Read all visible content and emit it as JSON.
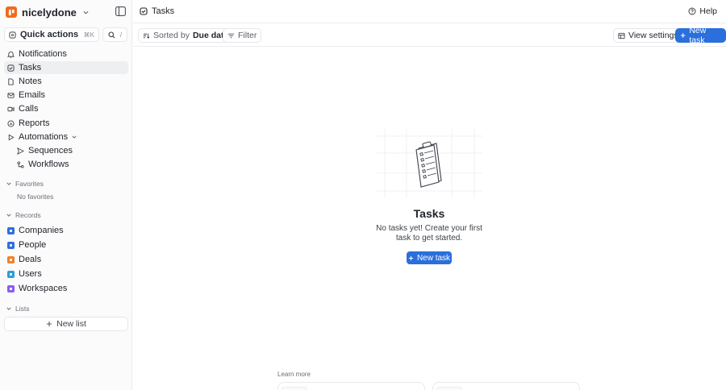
{
  "workspace": {
    "name": "nicelydone",
    "brand_color": "#f26a1b"
  },
  "quick_actions": {
    "label": "Quick actions",
    "shortcut": "⌘K",
    "slash": "/"
  },
  "nav": [
    {
      "label": "Notifications",
      "icon": "bell-icon"
    },
    {
      "label": "Tasks",
      "icon": "checkbox-icon",
      "active": true
    },
    {
      "label": "Notes",
      "icon": "note-icon"
    },
    {
      "label": "Emails",
      "icon": "mail-icon"
    },
    {
      "label": "Calls",
      "icon": "video-icon"
    },
    {
      "label": "Reports",
      "icon": "chart-icon"
    },
    {
      "label": "Automations",
      "icon": "play-icon"
    }
  ],
  "automations_sub": [
    {
      "label": "Sequences",
      "icon": "send-icon"
    },
    {
      "label": "Workflows",
      "icon": "workflow-icon"
    }
  ],
  "favorites": {
    "label": "Favorites",
    "empty": "No favorites"
  },
  "records": {
    "label": "Records",
    "items": [
      {
        "label": "Companies",
        "color": "#2f6fde"
      },
      {
        "label": "People",
        "color": "#2f6fde"
      },
      {
        "label": "Deals",
        "color": "#f0822a"
      },
      {
        "label": "Users",
        "color": "#2a9fd8"
      },
      {
        "label": "Workspaces",
        "color": "#8b5cf6"
      }
    ]
  },
  "lists": {
    "label": "Lists",
    "new_list": "New list"
  },
  "topbar": {
    "title": "Tasks",
    "help": "Help"
  },
  "toolbar": {
    "sort_prefix": "Sorted by",
    "sort_value": "Due date",
    "filter": "Filter",
    "view_settings": "View settings",
    "new_task": "New task",
    "accent": "#2a6fdc"
  },
  "empty_state": {
    "title": "Tasks",
    "description": "No tasks yet! Create your first task to get started.",
    "cta": "New task"
  },
  "learn_more": {
    "label": "Learn more"
  }
}
